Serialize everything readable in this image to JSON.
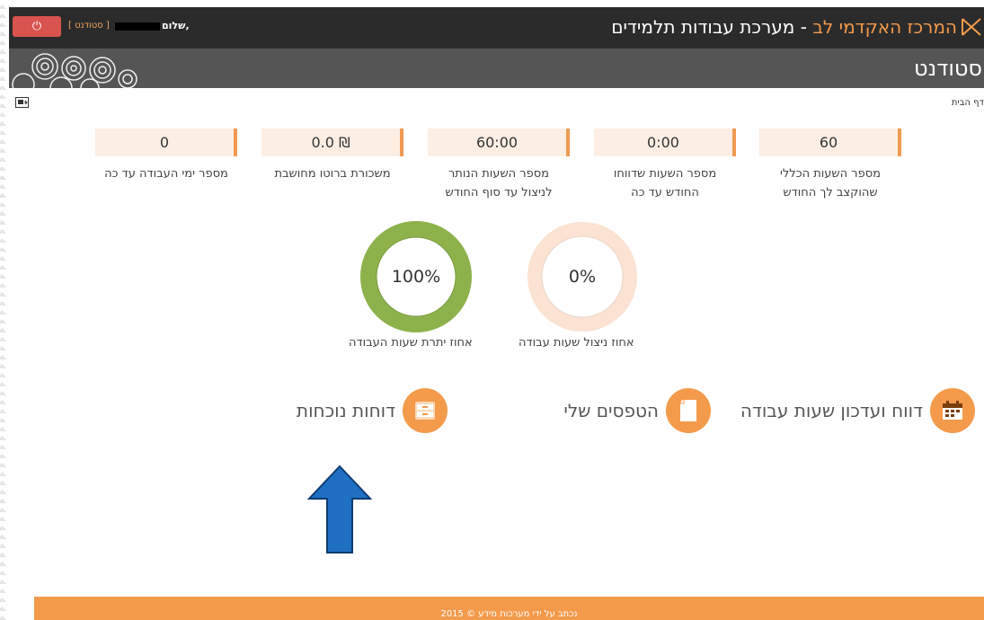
{
  "header": {
    "brand": "המרכז האקדמי לב",
    "separator": " - ",
    "app_name": "מערכת עבודות תלמידים",
    "greeting": "שלום,",
    "user_role": "[ סטודנט ]",
    "logout_icon": "power-icon"
  },
  "banner": {
    "title": "סטודנט"
  },
  "breadcrumb": "דף הבית",
  "stats": [
    {
      "value": "60",
      "label_line1": "מספר השעות הכללי",
      "label_line2": "שהוקצב לך החודש"
    },
    {
      "value": "0:00",
      "label_line1": "מספר השעות שדווחו",
      "label_line2": "החודש עד כה"
    },
    {
      "value": "60:00",
      "label_line1": "מספר השעות הנותר",
      "label_line2": "לניצול עד סוף החודש"
    },
    {
      "value": "0.0 ₪",
      "label_line1": "משכורת ברוטו מחושבת",
      "label_line2": ""
    },
    {
      "value": "0",
      "label_line1": "מספר ימי העבודה עד כה",
      "label_line2": ""
    }
  ],
  "donuts": [
    {
      "percent_text": "0%",
      "percent": 0,
      "label": "אחוז ניצול שעות עבודה",
      "color": "#fdeee3",
      "ring_color": "#fbe2d2"
    },
    {
      "percent_text": "100%",
      "percent": 100,
      "label": "אחוז יתרת שעות העבודה",
      "color": "#8db24c",
      "ring_color": "#9bbd58"
    }
  ],
  "actions": [
    {
      "label": "דווח ועדכון שעות עבודה",
      "icon": "calendar-icon"
    },
    {
      "label": "הטפסים שלי",
      "icon": "document-icon"
    },
    {
      "label": "דוחות נוכחות",
      "icon": "archive-drawer-icon"
    }
  ],
  "footer": {
    "text": "נכתב על ידי מערכות מידע © 2015"
  },
  "colors": {
    "accent": "#f49a4b",
    "topbar": "#2b2b2b",
    "banner": "#555555",
    "logout": "#d9534f",
    "arrow": "#1f6fc2"
  }
}
